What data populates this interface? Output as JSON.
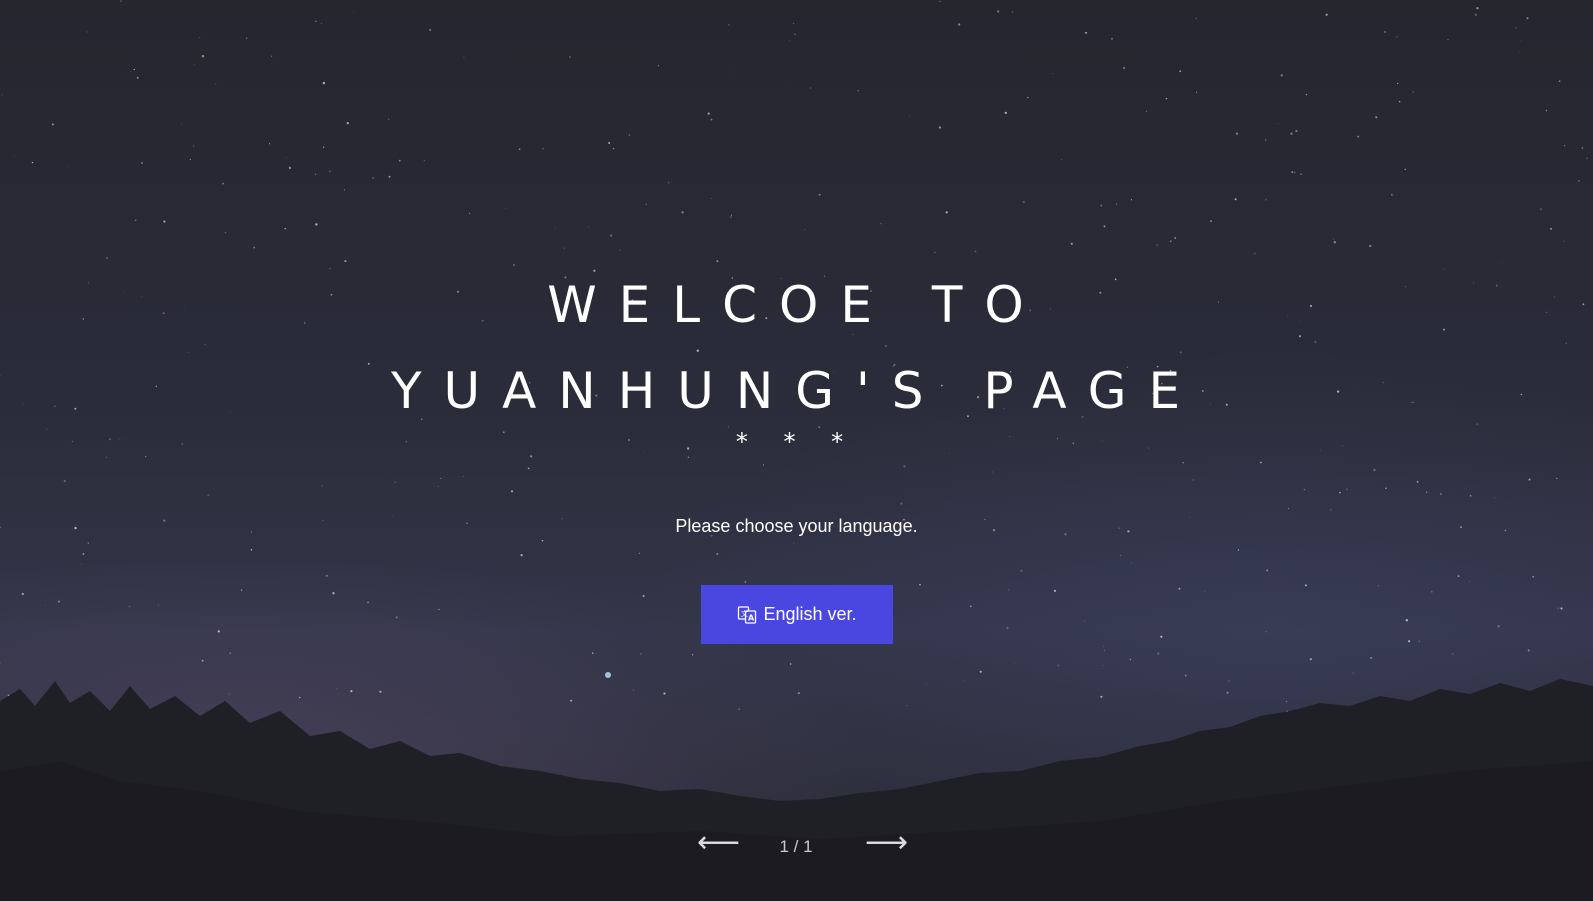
{
  "hero": {
    "title": "WELCOE TO YUANHUNG'S PAGE",
    "divider": "* * *",
    "subtitle": "Please choose your language.",
    "language_button": {
      "icon": "translate-icon",
      "label": "English ver.",
      "color": "#4a47e0"
    }
  },
  "pager": {
    "prev_icon": "arrow-left-icon",
    "next_icon": "arrow-right-icon",
    "prev_glyph": "⟵",
    "next_glyph": "⟶",
    "counter": "1 / 1"
  },
  "colors": {
    "background": "#2b2c3a",
    "text": "#ffffff"
  }
}
